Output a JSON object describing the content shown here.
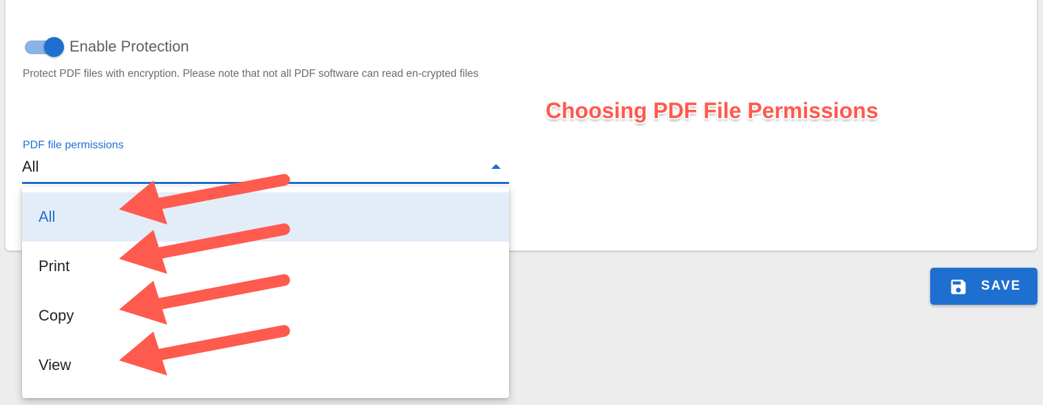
{
  "protection": {
    "toggle_label": "Enable Protection",
    "toggle_state": "on",
    "description": "Protect PDF files with encryption. Please note that not all PDF software can read en-crypted files"
  },
  "permissions": {
    "label": "PDF file permissions",
    "selected_value": "All",
    "options": [
      "All",
      "Print",
      "Copy",
      "View"
    ]
  },
  "save_button": {
    "label": "SAVE",
    "icon": "floppy-disk-icon"
  },
  "annotation": {
    "title": "Choosing PDF File Permissions",
    "arrow_color": "#ff5a4e"
  },
  "colors": {
    "accent": "#1f6fd1",
    "selected_row": "#e3edf8",
    "background": "#ededed"
  }
}
